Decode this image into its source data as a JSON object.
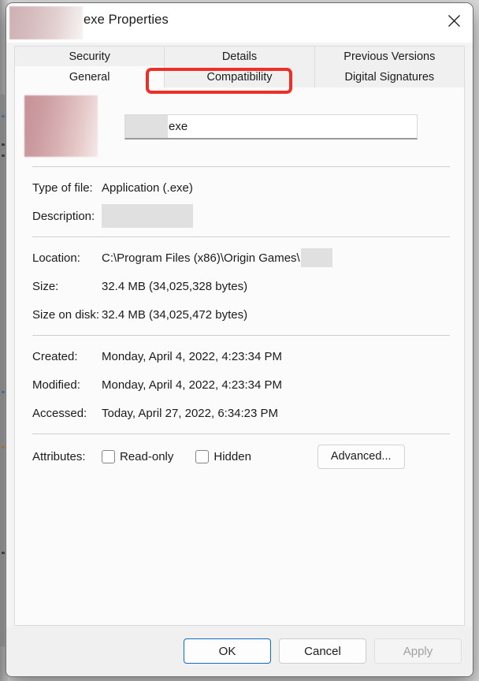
{
  "window": {
    "title": "exe Properties",
    "title_prefix_redacted": true,
    "close_icon": "close-icon"
  },
  "tabs": {
    "row_top": [
      {
        "label": "Security",
        "selected": false
      },
      {
        "label": "Details",
        "selected": false
      },
      {
        "label": "Previous Versions",
        "selected": false
      }
    ],
    "row_bottom": [
      {
        "label": "General",
        "selected": true
      },
      {
        "label": "Compatibility",
        "selected": false
      },
      {
        "label": "Digital Signatures",
        "selected": false
      }
    ]
  },
  "annotation": {
    "target": "Compatibility",
    "color": "#ee2f28",
    "shape": "rounded-rectangle-outline"
  },
  "general": {
    "filename_value": "exe",
    "filename_redacted": true,
    "icon_redacted": true,
    "rows": [
      {
        "label": "Type of file:",
        "value": "Application (.exe)",
        "redacted": false
      },
      {
        "label": "Description:",
        "value": "",
        "redacted": true
      },
      {
        "label": "Location:",
        "value": "C:\\Program Files (x86)\\Origin Games\\",
        "redacted": true
      },
      {
        "label": "Size:",
        "value": "32.4 MB (34,025,328 bytes)",
        "redacted": false
      },
      {
        "label": "Size on disk:",
        "value": "32.4 MB (34,025,472 bytes)",
        "redacted": false
      },
      {
        "label": "Created:",
        "value": "Monday, April 4, 2022, 4:23:34 PM",
        "redacted": false
      },
      {
        "label": "Modified:",
        "value": "Monday, April 4, 2022, 4:23:34 PM",
        "redacted": false
      },
      {
        "label": "Accessed:",
        "value": "Today, April 27, 2022, 6:34:23 PM",
        "redacted": false
      }
    ],
    "attributes": {
      "label": "Attributes:",
      "readonly_label": "Read-only",
      "readonly_checked": false,
      "hidden_label": "Hidden",
      "hidden_checked": false,
      "advanced_label": "Advanced..."
    }
  },
  "buttons": {
    "ok": "OK",
    "cancel": "Cancel",
    "apply": "Apply",
    "apply_disabled": true,
    "default_button": "OK",
    "accent_color": "#0f6cbd"
  }
}
